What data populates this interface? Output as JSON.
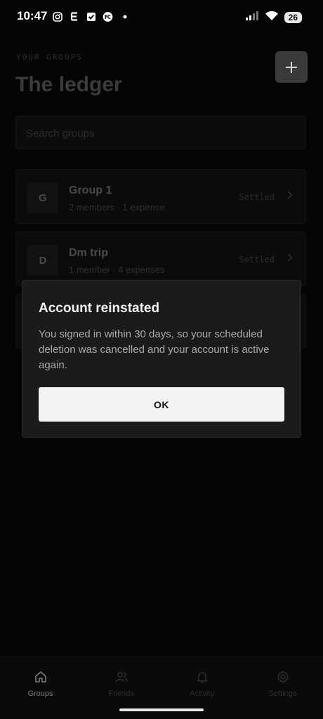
{
  "status_bar": {
    "time": "10:47",
    "battery": "26"
  },
  "header": {
    "eyebrow": "YOUR GROUPS",
    "title": "The ledger",
    "add_label": "+"
  },
  "search": {
    "placeholder": "Search groups"
  },
  "groups": [
    {
      "initial": "G",
      "name": "Group 1",
      "meta": "2 members · 1 expense",
      "status": "Settled"
    },
    {
      "initial": "D",
      "name": "Dm trip",
      "meta": "1 member · 4 expenses",
      "status": "Settled"
    }
  ],
  "dialog": {
    "title": "Account reinstated",
    "body": "You signed in within 30 days, so your scheduled deletion was cancelled and your account is active again.",
    "ok_label": "OK"
  },
  "tabs": [
    {
      "label": "Groups",
      "icon": "home-icon",
      "active": true
    },
    {
      "label": "Friends",
      "icon": "users-icon",
      "active": false
    },
    {
      "label": "Activity",
      "icon": "bell-icon",
      "active": false
    },
    {
      "label": "Settings",
      "icon": "gear-icon",
      "active": false
    }
  ]
}
